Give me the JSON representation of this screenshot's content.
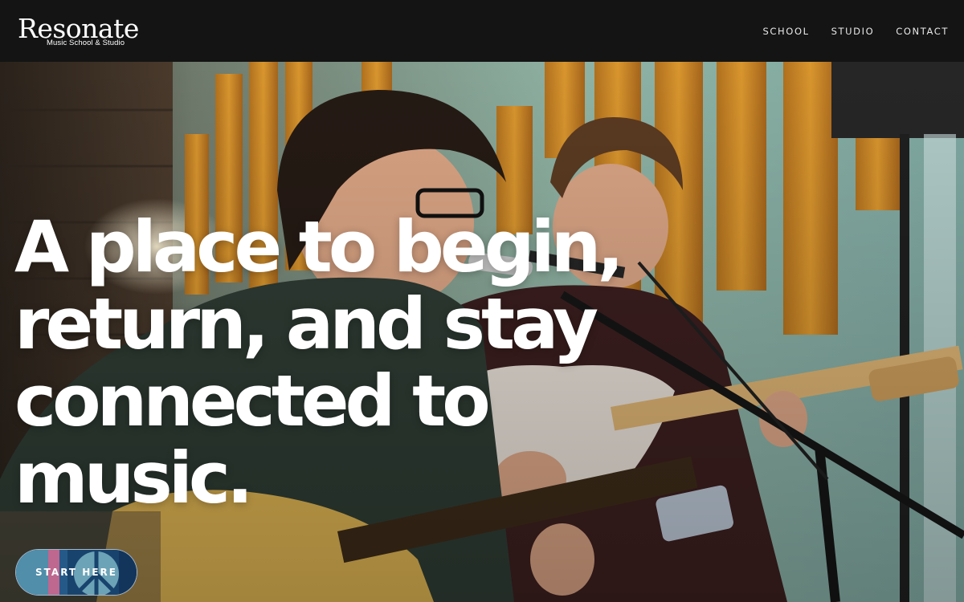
{
  "brand": {
    "name": "Resonate",
    "tagline": "Music School & Studio"
  },
  "nav": {
    "items": [
      "SCHOOL",
      "STUDIO",
      "CONTACT"
    ]
  },
  "hero": {
    "headline_lines": [
      "A place to begin,",
      "return, and stay",
      "connected to",
      "music."
    ],
    "cta_label": "START HERE",
    "image_description_icon": "guitarists-performing-photo"
  },
  "colors": {
    "header_bg": "#141414",
    "text": "#ffffff",
    "cta_bg": "#1d4f80"
  }
}
